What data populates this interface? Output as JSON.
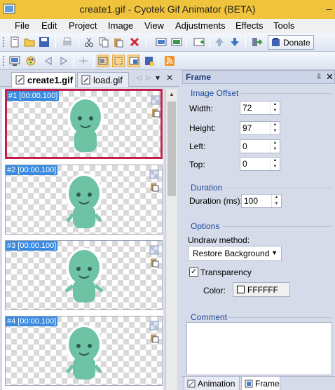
{
  "window": {
    "title": "create1.gif - Cyotek Gif Animator (BETA)",
    "minimize_glyph": "–"
  },
  "menu": [
    "File",
    "Edit",
    "Project",
    "Image",
    "View",
    "Adjustments",
    "Effects",
    "Tools"
  ],
  "toolbar": {
    "donate_label": "Donate",
    "icons_row1": [
      "new-icon",
      "open-icon",
      "save-icon",
      "print-icon",
      "cut-icon",
      "copy-icon",
      "paste-icon",
      "delete-icon",
      "frames-icon",
      "frame-export-icon",
      "add-frame-icon",
      "move-up-icon",
      "move-down-icon",
      "goto-icon",
      "donate-icon"
    ],
    "icons_row2": [
      "preview-icon",
      "palette-icon",
      "previous-icon",
      "next-icon",
      "split-icon",
      "fit-icon",
      "select-icon",
      "crop-icon",
      "save-frame-icon",
      "rss-icon"
    ]
  },
  "documents": {
    "tabs": [
      {
        "label": "create1.gif",
        "active": true
      },
      {
        "label": "load.gif",
        "active": false
      }
    ],
    "controls": {
      "prev": "◁",
      "next": "▷",
      "menu": "▾",
      "close": "✕"
    }
  },
  "frames": [
    {
      "label": "#1 [00:00.100]",
      "selected": true
    },
    {
      "label": "#2 [00:00.100]",
      "selected": false
    },
    {
      "label": "#3 [00:00.100]",
      "selected": false
    },
    {
      "label": "#4 [00:00.100]",
      "selected": false
    }
  ],
  "props": {
    "title": "Frame",
    "pin_glyph": "⫫",
    "close_glyph": "✕",
    "image_offset": {
      "group": "Image Offset",
      "width_label": "Width:",
      "width": "72",
      "height_label": "Height:",
      "height": "97",
      "left_label": "Left:",
      "left": "0",
      "top_label": "Top:",
      "top": "0"
    },
    "duration": {
      "group": "Duration",
      "label": "Duration (ms):",
      "value": "100"
    },
    "options": {
      "group": "Options",
      "undraw_label": "Undraw method:",
      "undraw_value": "Restore Background",
      "transparency_label": "Transparency",
      "transparency_checked": "✓",
      "color_label": "Color:",
      "color_value": "FFFFFF"
    },
    "comment": {
      "group": "Comment",
      "value": ""
    }
  },
  "bottom_tabs": [
    {
      "label": "Animation",
      "active": false
    },
    {
      "label": "Frame",
      "active": true
    }
  ],
  "colors": {
    "titlebar": "#f0c33c",
    "selected_frame_border": "#c2224a",
    "frame_label_bg": "#3a8be0",
    "character_body": "#6fc3a5",
    "group_label": "#1f4a9c"
  }
}
